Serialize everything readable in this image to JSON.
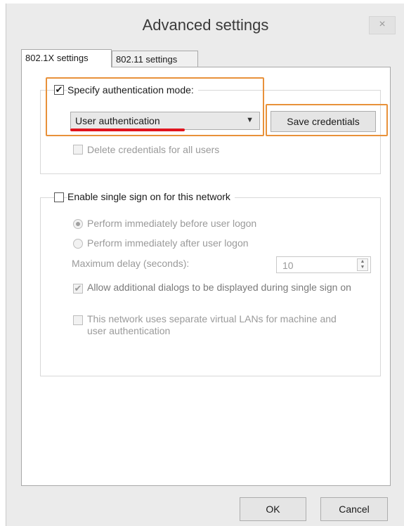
{
  "window": {
    "title": "Advanced settings",
    "close_glyph": "×"
  },
  "tabs": [
    {
      "label": "802.1X settings",
      "selected": true
    },
    {
      "label": "802.11 settings",
      "selected": false
    }
  ],
  "auth_group": {
    "specify_label": "Specify authentication mode:",
    "specify_checked": true,
    "mode_value": "User authentication",
    "save_button": "Save credentials",
    "delete_label": "Delete credentials for all users",
    "delete_checked": false
  },
  "sso_group": {
    "enable_label": "Enable single sign on for this network",
    "enable_checked": false,
    "radio_before": "Perform immediately before user logon",
    "radio_after": "Perform immediately after user logon",
    "selected_radio": "before",
    "delay_label": "Maximum delay (seconds):",
    "delay_value": "10",
    "allow_dialogs_label": "Allow additional dialogs to be displayed during single sign on",
    "allow_dialogs_checked": true,
    "vlan_label": "This network uses separate virtual LANs for machine and user authentication",
    "vlan_checked": false
  },
  "buttons": {
    "ok": "OK",
    "cancel": "Cancel"
  },
  "icons": {
    "checkmark": "✔",
    "dropdown": "▼",
    "spin_up": "▲",
    "spin_down": "▼"
  },
  "colors": {
    "highlight_box": "#e8913a",
    "underline": "#e0141e",
    "window_bg": "#ebebeb"
  }
}
